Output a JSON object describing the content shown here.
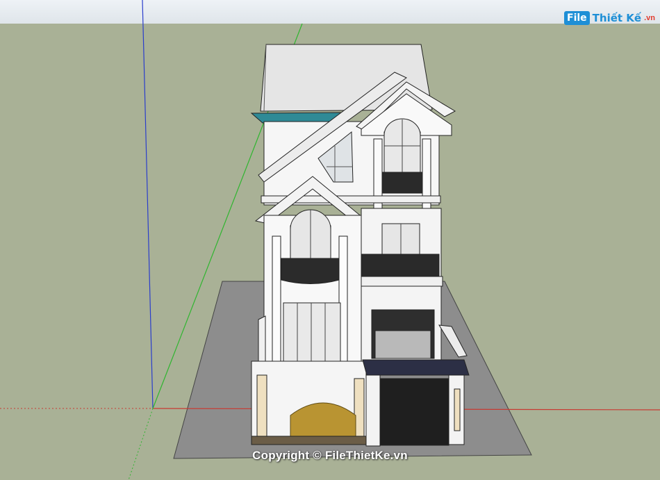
{
  "logo": {
    "badge": "File",
    "name": "Thiết Kế",
    "tld": ".vn"
  },
  "watermark": {
    "text": "Copyright © FileThietKe.vn"
  },
  "colors": {
    "ground": "#a9b196",
    "sky": "#e6ebf0",
    "lot": "#8e8e8e",
    "axis_red": "#c83a32",
    "axis_green": "#2fb52f",
    "axis_blue": "#2a3dcc",
    "wall": "#f7f7f7",
    "roof": "#e4e4e4",
    "gold_relief": "#b8952f",
    "gate": "#1e1e1e",
    "canopy": "#2c2f45"
  }
}
